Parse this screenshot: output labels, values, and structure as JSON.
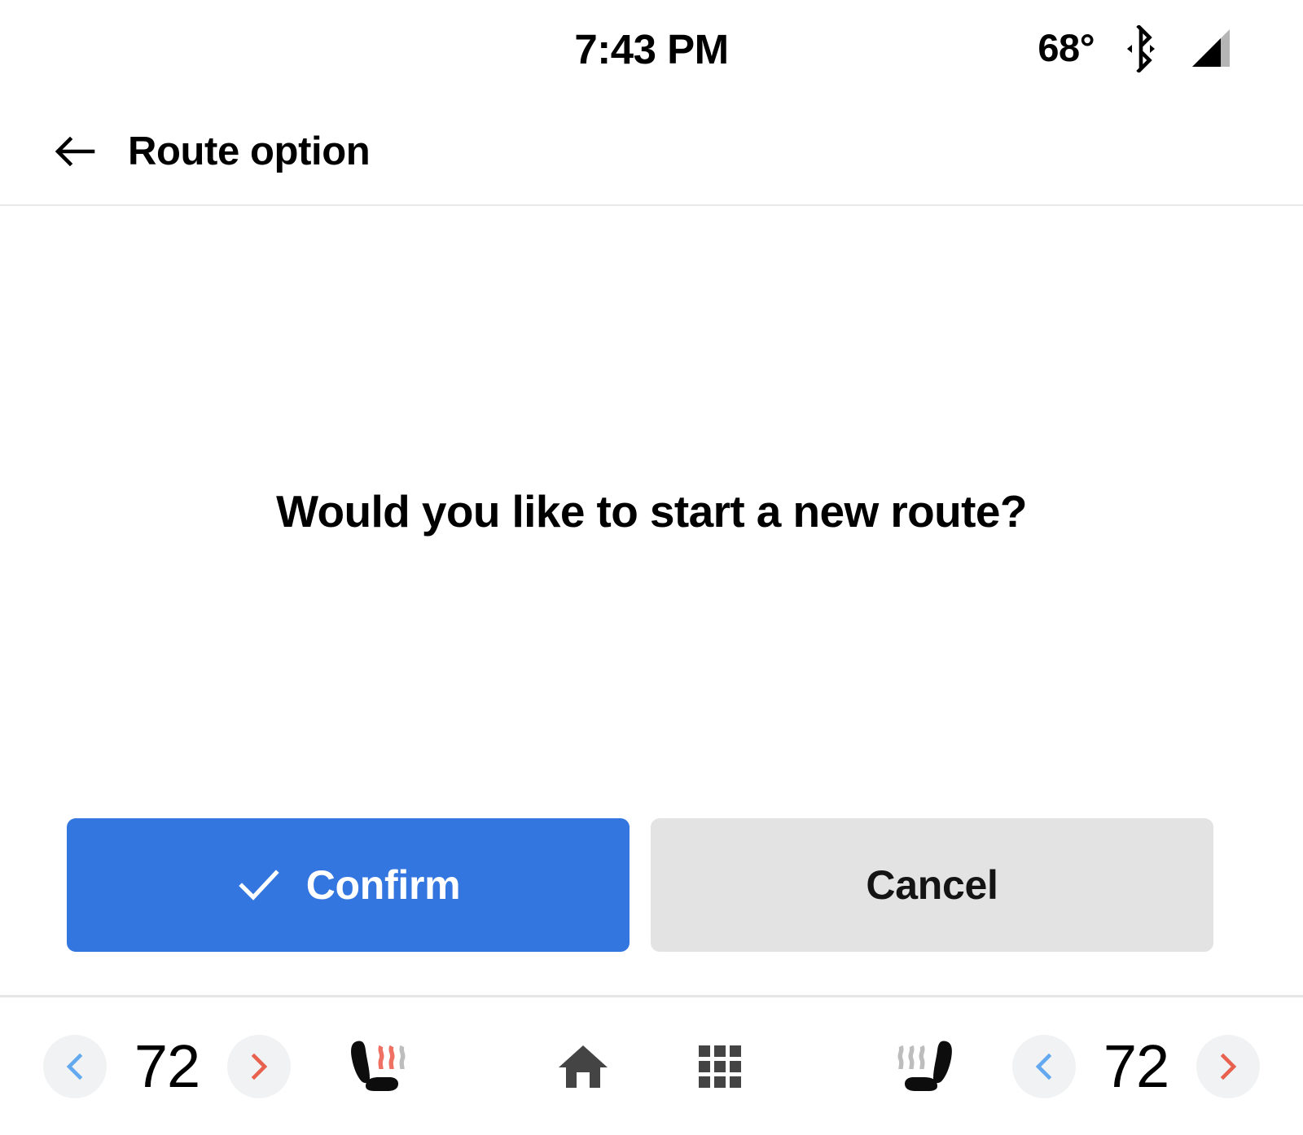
{
  "status_bar": {
    "time": "7:43 PM",
    "temperature": "68°",
    "bluetooth_icon": "bluetooth-icon",
    "signal_icon": "signal-bars-icon"
  },
  "header": {
    "back_icon": "back-arrow-icon",
    "title": "Route option"
  },
  "dialog": {
    "question": "Would you like to start a new route?",
    "confirm_label": "Confirm",
    "confirm_icon": "check-icon",
    "cancel_label": "Cancel"
  },
  "climate_bar": {
    "left": {
      "decrease_icon": "chevron-left-icon",
      "temperature": "72",
      "increase_icon": "chevron-right-icon",
      "seat_icon": "heated-seat-icon",
      "seat_heat_level": 2
    },
    "center": {
      "home_icon": "home-icon",
      "apps_icon": "apps-grid-icon"
    },
    "right": {
      "seat_icon": "heated-seat-icon",
      "seat_heat_level": 0,
      "decrease_icon": "chevron-left-icon",
      "temperature": "72",
      "increase_icon": "chevron-right-icon"
    }
  },
  "colors": {
    "accent_blue": "#3476e0",
    "cancel_gray": "#e3e3e3",
    "chevron_blue": "#62a9f0",
    "chevron_red": "#e8614f",
    "seat_heat_on": "#ef7164",
    "seat_heat_off": "#bdbdbd",
    "nav_icon": "#444444",
    "circle_bg": "#f1f2f3"
  }
}
